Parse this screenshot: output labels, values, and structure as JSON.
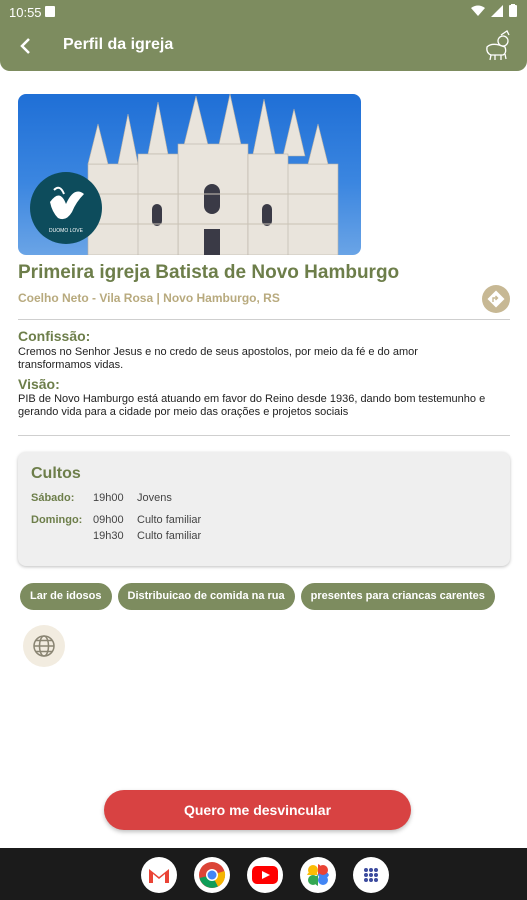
{
  "status": {
    "time": "10:55"
  },
  "appbar": {
    "title": "Perfil da igreja",
    "back_icon": "back-arrow-icon",
    "logo_icon": "lamb-logo-icon"
  },
  "church": {
    "name": "Primeira igreja Batista de Novo Hamburgo",
    "address": "Coelho Neto - Vila Rosa | Novo Hamburgo, RS",
    "logo_text": "DUOMO LOVE"
  },
  "sections": {
    "confession_label": "Confissão:",
    "confession_text": "Cremos no Senhor Jesus e no credo de seus apostolos, por meio da fé e do amor transformamos vidas.",
    "vision_label": "Visão:",
    "vision_text": "PIB de Novo Hamburgo está atuando em favor do Reino desde 1936, dando bom testemunho e gerando vida para a cidade por meio das orações e projetos sociais"
  },
  "cultos": {
    "title": "Cultos",
    "days": [
      {
        "day": "Sábado:",
        "slots": [
          {
            "time": "19h00",
            "name": "Jovens"
          }
        ]
      },
      {
        "day": "Domingo:",
        "slots": [
          {
            "time": "09h00",
            "name": "Culto familiar"
          },
          {
            "time": "19h30",
            "name": "Culto familiar"
          }
        ]
      }
    ]
  },
  "tags": [
    "Lar de idosos",
    "Distribuicao de comida na rua",
    "presentes para criancas carentes"
  ],
  "unlink_button": "Quero me desvincular",
  "colors": {
    "primary": "#7d8c5f",
    "accent_text": "#6d7e4a",
    "address": "#b8aa7e",
    "danger": "#d84242"
  },
  "dock": [
    "gmail-icon",
    "chrome-icon",
    "youtube-icon",
    "photos-icon",
    "app-drawer-icon"
  ]
}
